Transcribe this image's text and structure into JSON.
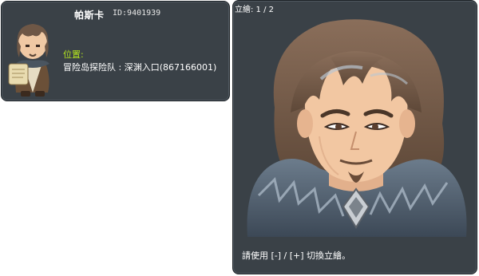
{
  "npc": {
    "name": "帕斯卡",
    "id": "ID:9401939",
    "location_label": "位置:",
    "location_value": "冒险岛探险队 : 深渊入口(867166001)"
  },
  "portrait": {
    "counter": "立繪: 1 / 2",
    "hint": "請使用 [-] / [+] 切換立繪。"
  },
  "colors": {
    "panel_bg": "#3a4147",
    "location_label": "#b4e61e",
    "text": "#ffffff"
  }
}
